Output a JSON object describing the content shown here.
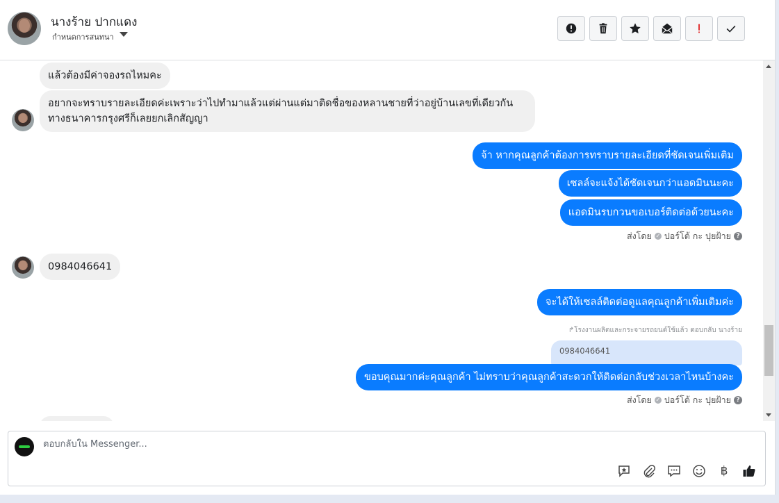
{
  "header": {
    "contact_name": "นางร้าย ปากแดง",
    "conversation_label": "กำหนดการสนทนา",
    "actions": [
      "alert-circle-icon",
      "trash-icon",
      "star-icon",
      "envelope-icon",
      "important-icon",
      "check-icon"
    ]
  },
  "messages": {
    "in_1": "แล้วต้องมีค่าจองรถไหมคะ",
    "in_2": "อยากจะทราบรายละเอียดค่ะเพราะว่าไปทำมาแล้วแต่ผ่านแต่มาติดชื่อของหลานชายที่ว่าอยู่บ้านเลขที่เดียวกันทางธนาคารกรุงศรีก็เลยยกเลิกสัญญา",
    "out_1": "จ้า หากคุณลูกค้าต้องการทราบรายละเอียดที่ชัดเจนเพิ่มเติม",
    "out_2": "เซลล์จะแจ้งได้ชัดเจนกว่าแอดมินนะคะ",
    "out_3": "แอดมินรบกวนขอเบอร์ติดต่อด้วยนะคะ",
    "sent_by_label_1": "ส่งโดย",
    "sent_by_name_1": "ปอร์โต้ กะ ปุยฝ้าย",
    "in_3": "0984046641",
    "out_4": "จะได้ให้เซลล์ติดต่อดูแลคุณลูกค้าเพิ่มเติมค่ะ",
    "reply_note": "โรงงานผลิตและกระจายรถยนต์ใช้แล้ว ตอบกลับ นางร้าย",
    "quoted_text": "0984046641",
    "out_5": "ขอบคุณมากค่ะคุณลูกค้า ไม่ทราบว่าคุณลูกค้าสะดวกให้ติดต่อกลับช่วงเวลาไหนบ้างคะ",
    "sent_by_label_2": "ส่งโดย",
    "sent_by_name_2": "ปอร์โต้ กะ ปุยฝ้าย"
  },
  "composer": {
    "placeholder": "ตอบกลับใน Messenger...",
    "tools": [
      "saved-reply-icon",
      "attachment-icon",
      "chat-bubble-icon",
      "emoji-icon",
      "baht-icon",
      "thumbs-up-icon"
    ],
    "baht_symbol": "฿"
  },
  "colors": {
    "outgoing_bubble": "#0a7cff",
    "incoming_bubble": "#f0f0f0",
    "quote_bubble": "#d8e6fb"
  }
}
